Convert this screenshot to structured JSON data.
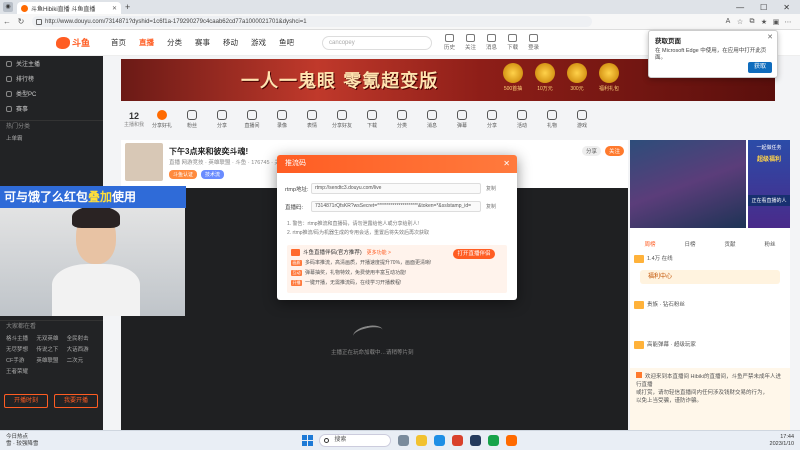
{
  "browser": {
    "tab_title": "斗鱼Hibiki直播 斗鱼直播",
    "url": "http://www.douyu.com/7314871?dyshid=1c6f1a-179290279c4caab62cd77a1000021701&dyshci=1",
    "new_tab": "+",
    "back": "←",
    "reload": "↻",
    "min": "—",
    "max": "☐",
    "close": "✕"
  },
  "edge_popup": {
    "title": "获取页面",
    "desc": "在 Microsoft Edge 中使用，在应用中打开此页面。",
    "button": "获取",
    "close": "✕"
  },
  "site": {
    "logo": "斗鱼",
    "nav": [
      "首页",
      "直播",
      "分类",
      "赛事",
      "移动",
      "游戏",
      "鱼吧"
    ],
    "search_placeholder": "cancopey",
    "header_icons": [
      "历史",
      "关注",
      "消息",
      "下载",
      "登录"
    ]
  },
  "sidebar": {
    "items": [
      "关注主播",
      "排行榜",
      "类型PC",
      "赛事"
    ],
    "section1": "热门分类",
    "section2": "大家都在看",
    "grid": [
      "上单霸",
      "格斗主播",
      "无双英雄",
      "全民射击",
      "无尽梦想",
      "传说之下",
      "大话西游",
      "CF手游",
      "英雄联盟",
      "二次元",
      "王者荣耀"
    ],
    "btn_left": "开播时刻",
    "btn_right": "我要开播"
  },
  "banner": {
    "title": "一人一鬼眼 零氪超变版",
    "rewards": [
      "500首抽",
      "10万元",
      "300元",
      "福利礼包"
    ]
  },
  "categories": {
    "count": "12",
    "count_label": "主播和我",
    "items": [
      "分享好礼",
      "粉丝",
      "分享",
      "直播间",
      "录像",
      "表情",
      "分享好友",
      "下载",
      "分类",
      "消息",
      "弹幕",
      "分享",
      "活动",
      "礼物",
      "游戏"
    ]
  },
  "stream": {
    "title": "下午3点来和彼奕斗魂!",
    "meta": "直播  网游竞技 · 英雄联盟 · 斗鱼  ·  176745  ·  关注",
    "tags": [
      "斗鱼认证",
      "技术流"
    ],
    "buttons": [
      "分享",
      "关注"
    ]
  },
  "webcam_overlay": {
    "text_a": "可与饿了么红包",
    "text_hl": "叠加",
    "text_b": "使用"
  },
  "player": {
    "loading": "主播正在玩命加载中…请稍等片刻"
  },
  "dialog": {
    "title": "推流码",
    "close": "✕",
    "rtmp_label": "rtmp地址:",
    "rtmp_value": "rtmp://sendtc3.douyu.com/live",
    "stream_label": "直播码:",
    "stream_value": "7314871rQfsKR?wsSecret=*********************&token=*&sslstamp_id=",
    "copy": "复制",
    "notes": [
      "1. 警告：rtmp推流和直播码，请勿泄露给他人或分享给别人!",
      "2. rtmp推流/码为机器生成的专用会话，重置后将失效后再次获取"
    ],
    "promo": {
      "title": "斗鱼直播伴侣(官方推荐)",
      "link": "更多功能 >",
      "open": "打开直播伴侣",
      "lines": [
        [
          "画质",
          "多码率推流，高清画质，开播速度提升70%，画面更清晰!"
        ],
        [
          "互动",
          "弹幕抽奖，礼物特效，免费使用丰富互动功能!"
        ],
        [
          "开播",
          "一键开播，无需推流码，在线学习开播教程!"
        ]
      ]
    }
  },
  "right": {
    "side_top": "一起做任务",
    "side_mid": "超级福利",
    "side_bottom": "正在看直播的人",
    "tabs": [
      "周榜",
      "日榜",
      "贡献",
      "粉丝"
    ],
    "activity": "福利中心",
    "rows": [
      "1.4万 在线",
      "贵族  · 钻石粉丝",
      "高能弹幕 · 超级玩家"
    ],
    "chat": [
      "欢迎来到本直播间 Hibiki的直播间，斗鱼严禁未成年人进行直播",
      "或打赏，请勿轻信直播间内任何涉及钱财交易的行为，",
      "以免上当受骗，谨防诈骗。"
    ]
  },
  "taskbar": {
    "weather_top": "今日热点",
    "weather_bottom": "雪 · 较强降雪",
    "search": "搜索",
    "time": "17:44",
    "date": "2023/1/10"
  }
}
